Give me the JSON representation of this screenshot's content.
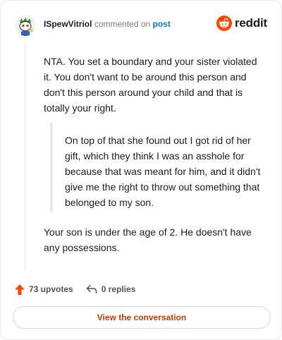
{
  "comment": {
    "username": "ISpewVitriol",
    "action_text": "commented on",
    "post_link": "post",
    "paragraphs": [
      "NTA. You set a boundary and your sister violated it. You don't want to be around this person and don't this person around your child and that is totally your right.",
      "Your son is under the age of 2. He doesn't have any possessions."
    ],
    "quote": "On top of that she found out I got rid of her gift, which they think I was an asshole for because that was meant for him, and it didn't give me the right to throw out something that belonged to my son."
  },
  "brand": {
    "name": "reddit",
    "icon": "reddit-alien-icon",
    "color": "#ff4500"
  },
  "footer": {
    "upvotes": "73 upvotes",
    "replies": "0 replies",
    "upvote_icon": "upvote-arrow-icon",
    "reply_icon": "reply-arrow-icon"
  },
  "cta": {
    "label": "View the conversation"
  }
}
